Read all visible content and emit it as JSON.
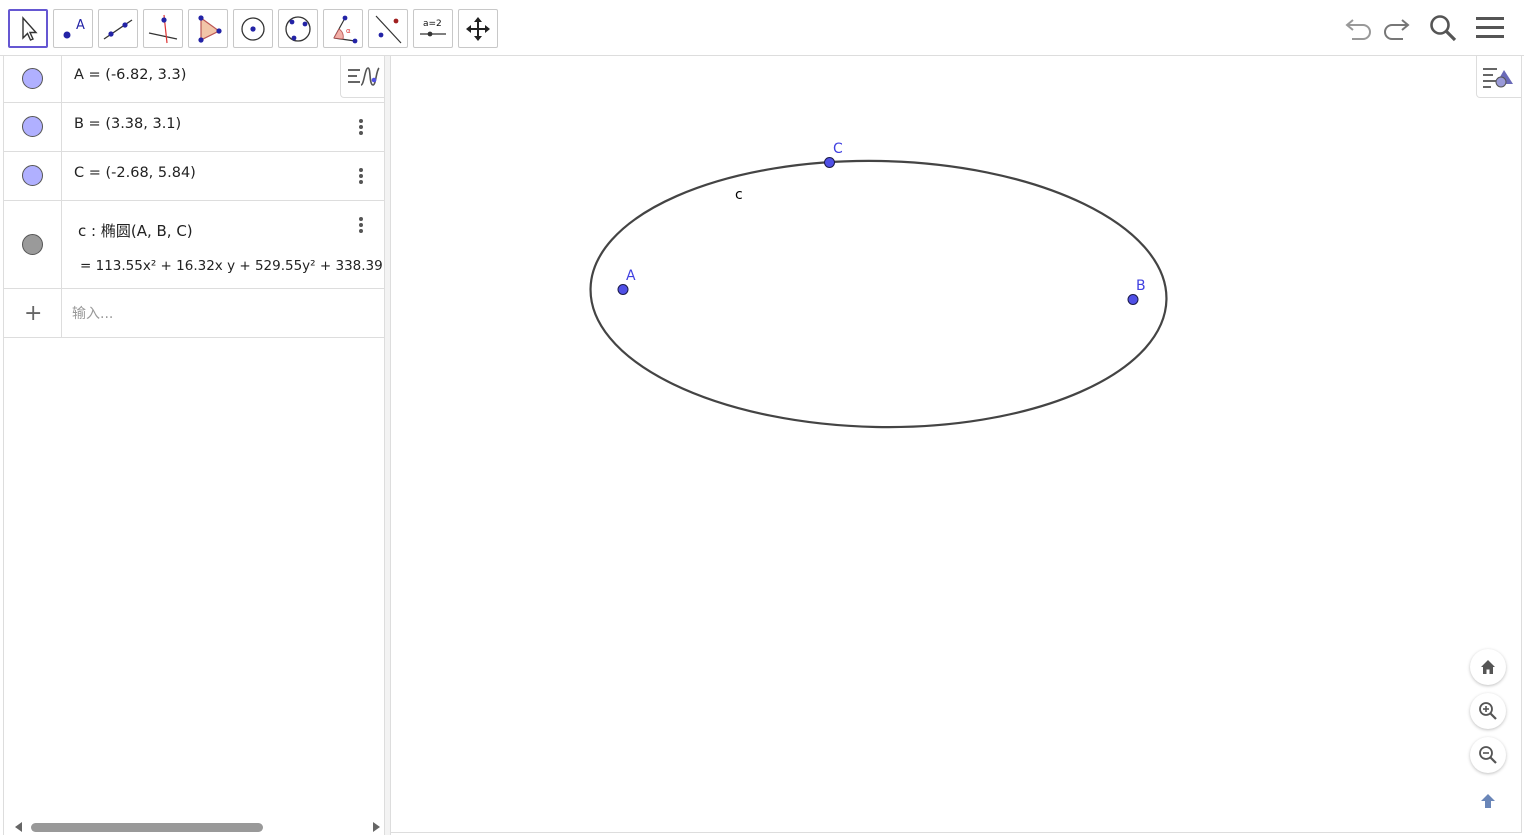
{
  "toolbar": {
    "tools": [
      {
        "name": "move-tool",
        "label": ""
      },
      {
        "name": "point-tool",
        "label": "A"
      },
      {
        "name": "line-tool",
        "label": ""
      },
      {
        "name": "perpendicular-line-tool",
        "label": ""
      },
      {
        "name": "polygon-tool",
        "label": ""
      },
      {
        "name": "circle-center-point-tool",
        "label": ""
      },
      {
        "name": "circle-three-points-tool",
        "label": ""
      },
      {
        "name": "angle-tool",
        "label": ""
      },
      {
        "name": "reflect-tool",
        "label": ""
      },
      {
        "name": "slider-tool",
        "label": "a=2"
      },
      {
        "name": "move-graphics-view-tool",
        "label": ""
      }
    ],
    "right_buttons": [
      "undo-icon",
      "redo-icon",
      "search-icon",
      "menu-icon"
    ]
  },
  "algebra": {
    "items": [
      {
        "id": "A",
        "text": "A = (-6.82, 3.3)",
        "color": "#9999ff"
      },
      {
        "id": "B",
        "text": "B = (3.38, 3.1)",
        "color": "#9999ff"
      },
      {
        "id": "C",
        "text": "C = (-2.68, 5.84)",
        "color": "#9999ff"
      },
      {
        "id": "c",
        "definition": "c : 椭圆(A, B, C)",
        "value": "=  113.55x² + 16.32x y + 529.55y² + 338.39",
        "color": "#808080"
      }
    ],
    "input_placeholder": "输入..."
  },
  "graphics": {
    "points": [
      {
        "label": "A"
      },
      {
        "label": "B"
      },
      {
        "label": "C"
      }
    ],
    "conic_label": "c",
    "point_color": "#5050e6",
    "label_color": "#4040e0",
    "curve_color": "#444444"
  }
}
